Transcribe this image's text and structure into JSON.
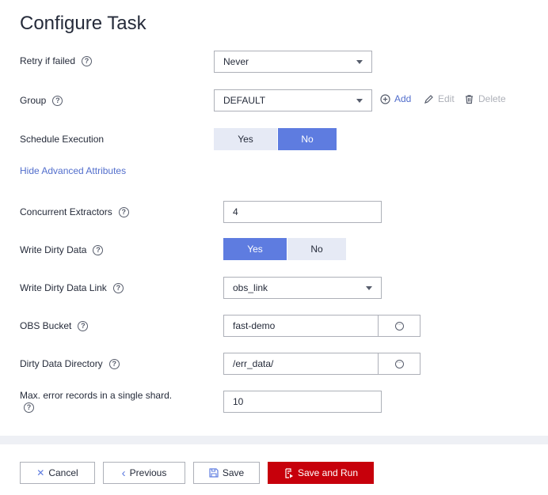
{
  "page": {
    "title": "Configure Task"
  },
  "form": {
    "retry": {
      "label": "Retry if failed",
      "value": "Never"
    },
    "group": {
      "label": "Group",
      "value": "DEFAULT",
      "add": "Add",
      "edit": "Edit",
      "delete": "Delete"
    },
    "schedule": {
      "label": "Schedule Execution",
      "options": [
        "Yes",
        "No"
      ],
      "selected": "No"
    },
    "advanced_link": "Hide Advanced Attributes",
    "concurrent": {
      "label": "Concurrent Extractors",
      "value": "4"
    },
    "dirty_data": {
      "label": "Write Dirty Data",
      "options": [
        "Yes",
        "No"
      ],
      "selected": "Yes"
    },
    "dirty_link": {
      "label": "Write Dirty Data Link",
      "value": "obs_link"
    },
    "obs_bucket": {
      "label": "OBS Bucket",
      "value": "fast-demo"
    },
    "dirty_dir": {
      "label": "Dirty Data Directory",
      "value": "/err_data/"
    },
    "max_errors": {
      "label": "Max. error records in a single shard.",
      "value": "10"
    }
  },
  "footer": {
    "cancel": "Cancel",
    "previous": "Previous",
    "save": "Save",
    "save_run": "Save and Run"
  },
  "colors": {
    "accent": "#5e7ce0",
    "link": "#526ecc",
    "danger": "#c7000b",
    "toggle_bg": "#e6eaf5"
  }
}
